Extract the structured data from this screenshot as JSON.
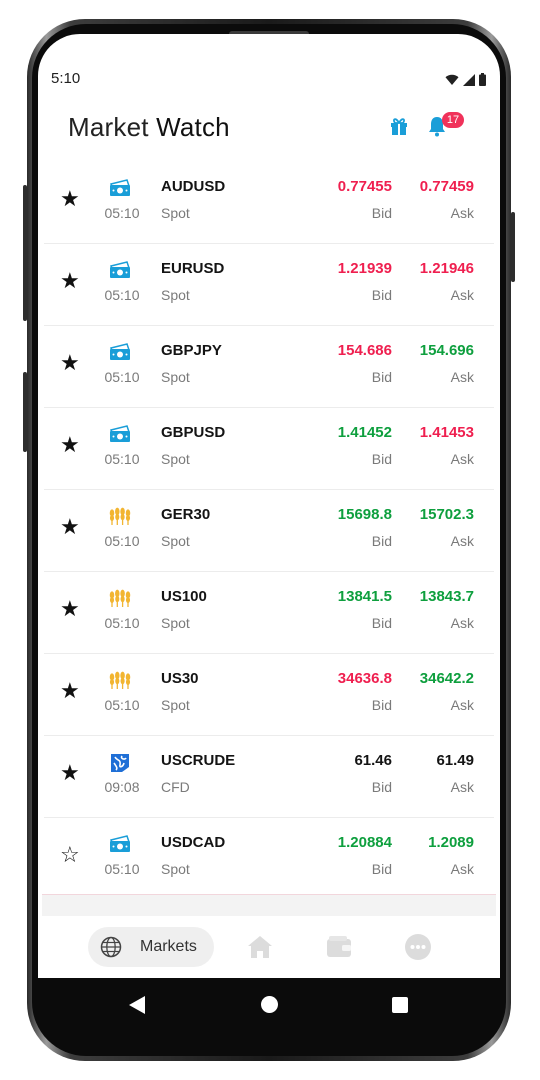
{
  "status": {
    "time": "5:10"
  },
  "header": {
    "title_part1": "Market",
    "title_part2": "Watch",
    "notification_count": "17"
  },
  "colors": {
    "red": "#ef1f4f",
    "green": "#0e9f3e",
    "black": "#141414",
    "icon_blue": "#1a9ed8",
    "icon_gold": "#f2b531",
    "crude_blue": "#1f6fd6"
  },
  "columns": {
    "bid_label": "Bid",
    "ask_label": "Ask"
  },
  "instruments": [
    {
      "star": "★",
      "icon": "banknote-icon",
      "time": "05:10",
      "symbol": "AUDUSD",
      "type": "Spot",
      "bid": "0.77455",
      "bid_color": "red",
      "ask": "0.77459",
      "ask_color": "red"
    },
    {
      "star": "★",
      "icon": "banknote-icon",
      "time": "05:10",
      "symbol": "EURUSD",
      "type": "Spot",
      "bid": "1.21939",
      "bid_color": "red",
      "ask": "1.21946",
      "ask_color": "red"
    },
    {
      "star": "★",
      "icon": "banknote-icon",
      "time": "05:10",
      "symbol": "GBPJPY",
      "type": "Spot",
      "bid": "154.686",
      "bid_color": "red",
      "ask": "154.696",
      "ask_color": "green"
    },
    {
      "star": "★",
      "icon": "banknote-icon",
      "time": "05:10",
      "symbol": "GBPUSD",
      "type": "Spot",
      "bid": "1.41452",
      "bid_color": "green",
      "ask": "1.41453",
      "ask_color": "red"
    },
    {
      "star": "★",
      "icon": "wheat-icon",
      "time": "05:10",
      "symbol": "GER30",
      "type": "Spot",
      "bid": "15698.8",
      "bid_color": "green",
      "ask": "15702.3",
      "ask_color": "green"
    },
    {
      "star": "★",
      "icon": "wheat-icon",
      "time": "05:10",
      "symbol": "US100",
      "type": "Spot",
      "bid": "13841.5",
      "bid_color": "green",
      "ask": "13843.7",
      "ask_color": "green"
    },
    {
      "star": "★",
      "icon": "wheat-icon",
      "time": "05:10",
      "symbol": "US30",
      "type": "Spot",
      "bid": "34636.8",
      "bid_color": "red",
      "ask": "34642.2",
      "ask_color": "green"
    },
    {
      "star": "★",
      "icon": "crude-oil-icon",
      "time": "09:08",
      "symbol": "USCRUDE",
      "type": "CFD",
      "bid": "61.46",
      "bid_color": "black",
      "ask": "61.49",
      "ask_color": "black"
    },
    {
      "star": "☆",
      "icon": "banknote-icon",
      "time": "05:10",
      "symbol": "USDCAD",
      "type": "Spot",
      "bid": "1.20884",
      "bid_color": "green",
      "ask": "1.2089",
      "ask_color": "green"
    }
  ],
  "bottom_nav": {
    "markets_label": "Markets"
  }
}
